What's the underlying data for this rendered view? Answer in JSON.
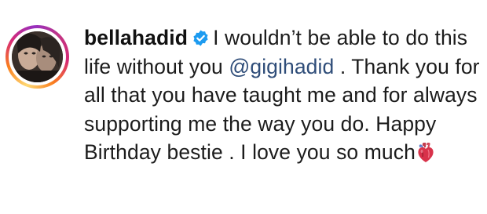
{
  "comment": {
    "username": "bellahadid",
    "verified_icon": "verified-badge-icon",
    "text_before_mention": "I wouldn’t be able to do this life without you",
    "mention": "@gigihadid",
    "text_after_mention": ". Thank you for all that you have taught me and for always supporting me the way you do. Happy Birthday bestie . I love you so much",
    "emoji_icon": "anatomical-heart-icon"
  },
  "colors": {
    "mention": "#2f4d79",
    "verified": "#1d9bf0",
    "text": "#1c1c1c"
  }
}
